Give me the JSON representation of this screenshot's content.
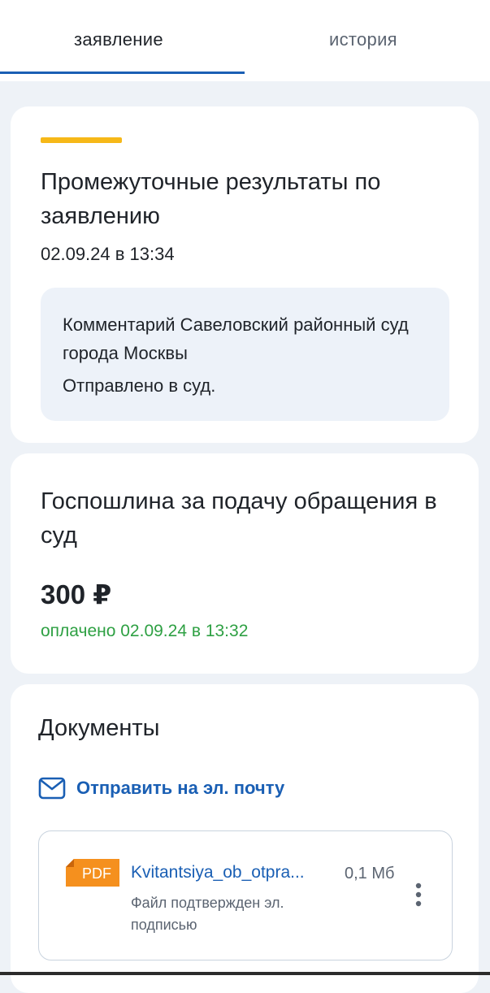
{
  "tabs": [
    {
      "label": "заявление",
      "active": true
    },
    {
      "label": "история",
      "active": false
    }
  ],
  "result_card": {
    "title": "Промежуточные результаты по заявлению",
    "date": "02.09.24 в 13:34",
    "comment_title": "Комментарий Савеловский районный суд города Москвы",
    "comment_text": "Отправлено в суд."
  },
  "fee_card": {
    "title": "Госпошлина за подачу обращения в суд",
    "amount": "300 ₽",
    "status": "оплачено 02.09.24 в 13:32"
  },
  "documents": {
    "title": "Документы",
    "send_email_label": "Отправить на эл. почту",
    "files": [
      {
        "type_badge": "PDF",
        "name": "Kvitantsiya_ob_otpra...",
        "size": "0,1 Мб",
        "note": "Файл подтвержден эл. подписью"
      }
    ]
  },
  "colors": {
    "accent": "#f6b818",
    "link": "#1a5fb4",
    "success": "#2ea043",
    "pdf_badge": "#f5901e",
    "background": "#eef2f7"
  },
  "icons": {
    "mail": "mail-icon",
    "more": "more-vertical-icon",
    "pdf": "pdf-file-icon"
  }
}
